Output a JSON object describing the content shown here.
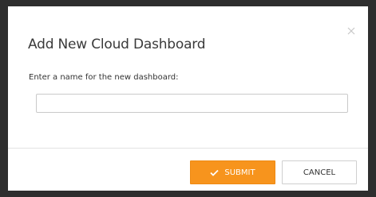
{
  "dialog": {
    "title": "Add New Cloud Dashboard",
    "field_label": "Enter a name for the new dashboard:",
    "name_value": "",
    "name_placeholder": "",
    "close_icon": "close-icon",
    "buttons": {
      "submit_label": "SUBMIT",
      "submit_icon": "check-icon",
      "cancel_label": "CANCEL"
    }
  },
  "colors": {
    "accent": "#f7941d",
    "backdrop": "#2e2e2e",
    "dialog_bg": "#ffffff"
  }
}
